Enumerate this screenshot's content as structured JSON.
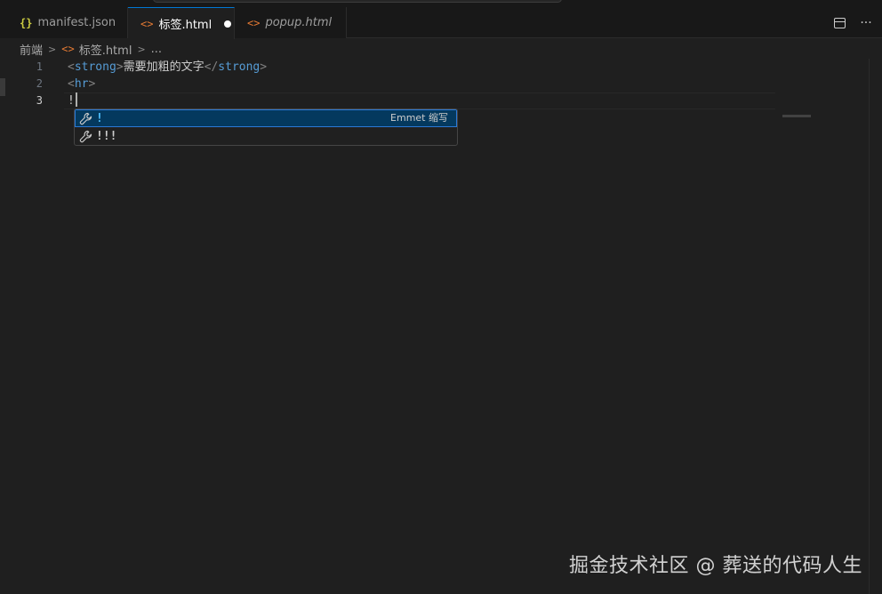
{
  "tabs": [
    {
      "label": "manifest.json",
      "icon": "json-braces-icon",
      "active": false,
      "italic": false
    },
    {
      "label": "标签.html",
      "icon": "html-angle-icon",
      "active": true,
      "dirty": true,
      "italic": false
    },
    {
      "label": "popup.html",
      "icon": "html-angle-icon",
      "active": false,
      "italic": true
    }
  ],
  "tab_actions": {
    "split_icon": "split-editor-icon",
    "more_glyph": "···"
  },
  "breadcrumb": {
    "folder": "前端",
    "file": "标签.html",
    "ellipsis": "..."
  },
  "editor": {
    "line_numbers": [
      "1",
      "2",
      "3"
    ],
    "current_line": 3,
    "lines": [
      {
        "open_lt": "<",
        "tag": "strong",
        "open_gt": ">",
        "text": "需要加粗的文字",
        "close_lt": "</",
        "close_tag": "strong",
        "close_gt": ">"
      },
      {
        "lt": "<",
        "tag": "hr",
        "gt": ">"
      },
      {
        "text": "!"
      }
    ]
  },
  "suggestions": [
    {
      "label": "!",
      "detail": "Emmet 缩写",
      "icon": "wrench-icon",
      "selected": true
    },
    {
      "label": "!!!",
      "detail": "",
      "icon": "wrench-icon",
      "selected": false
    }
  ],
  "watermark": "掘金技术社区 @ 葬送的代码人生",
  "colors": {
    "accent": "#0078d4",
    "tag": "#569cd6",
    "selection": "#04395e",
    "html_icon": "#e37933",
    "json_icon": "#cbcb41"
  }
}
